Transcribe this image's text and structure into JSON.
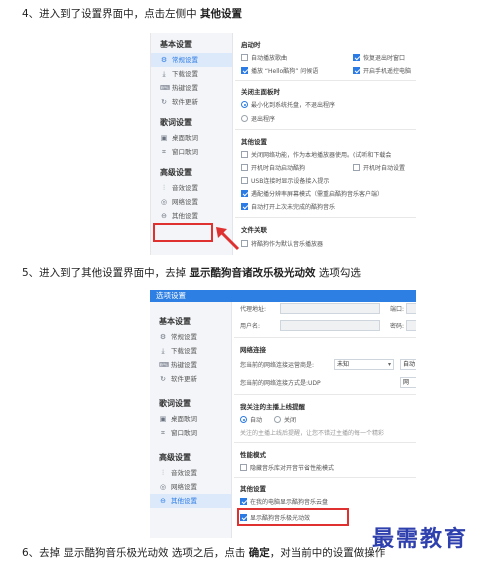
{
  "steps": {
    "s4_pre": "4、进入到了设置界面中，点击左侧中 ",
    "s4_bold": "其他设置",
    "s5_pre": "5、进入到了其他设置界面中，去掉 ",
    "s5_bold": "显示酷狗音诸改乐极光动效",
    "s5_post": " 选项勾选",
    "s6_pre": "6、去掉 显示酷狗音乐极光动效 选项之后，点击 ",
    "s6_bold": "确定",
    "s6_post": "，对当前中的设置做操作"
  },
  "sidebar": {
    "basic": "基本设置",
    "items_basic": [
      "常规设置",
      "下载设置",
      "热键设置",
      "软件更新"
    ],
    "lyrics": "歌词设置",
    "items_lyrics": [
      "桌面歌词",
      "窗口歌词"
    ],
    "advanced": "高级设置",
    "items_adv": [
      "音效设置",
      "网络设置",
      "其他设置"
    ]
  },
  "shot1": {
    "startup": "启动时",
    "o1": "自动播放歌曲",
    "o2": "恢复退出时窗口",
    "o3": "播放 “Hello酷狗” 问候语",
    "o4": "开启手机遥控电脑",
    "close_title": "关闭主面板时",
    "r1": "最小化到系统托盘，不退出程序",
    "r2": "退出程序",
    "other": "其他设置",
    "c1": "关闭网络功能，作为本地播放器使用。(试听和下载会",
    "c2": "开机时自动启动酷狗",
    "c3": "开机时自动设置",
    "c4": "USB连接时显示设备接入提示",
    "c5": "遇配播分辨率屏幕模式（需重启酷狗音乐客户端）",
    "c6": "自动打开上次未完成的酷狗音乐",
    "assoc": "文件关联",
    "a1": "将酷狗作为默认音乐播放器"
  },
  "shot2": {
    "titlebar": "选项设置",
    "proxy_addr": "代理地址:",
    "port": "端口:",
    "username": "用户名:",
    "password": "密码:",
    "net_conn": "网络连接",
    "net_env": "您当前的网络连接运营商是:",
    "net_env_val": "未知",
    "auto_label": "自动",
    "net_type": "您当前的网络连接方式是:UDP",
    "net_type_val": "网",
    "follow": "我关注的主播上线提醒",
    "f_auto": "自动",
    "f_off": "关闭",
    "follow_desc": "关注的主播上线后提醒，让您不错过主播的每一个精彩",
    "perf": "性能模式",
    "perf1": "隐藏音乐库对开音节省性能模式",
    "other": "其他设置",
    "o1": "在我的电脑显示酷狗音乐云盘",
    "o2": "显示酷狗音乐极光动效"
  },
  "watermark": "最需教育"
}
